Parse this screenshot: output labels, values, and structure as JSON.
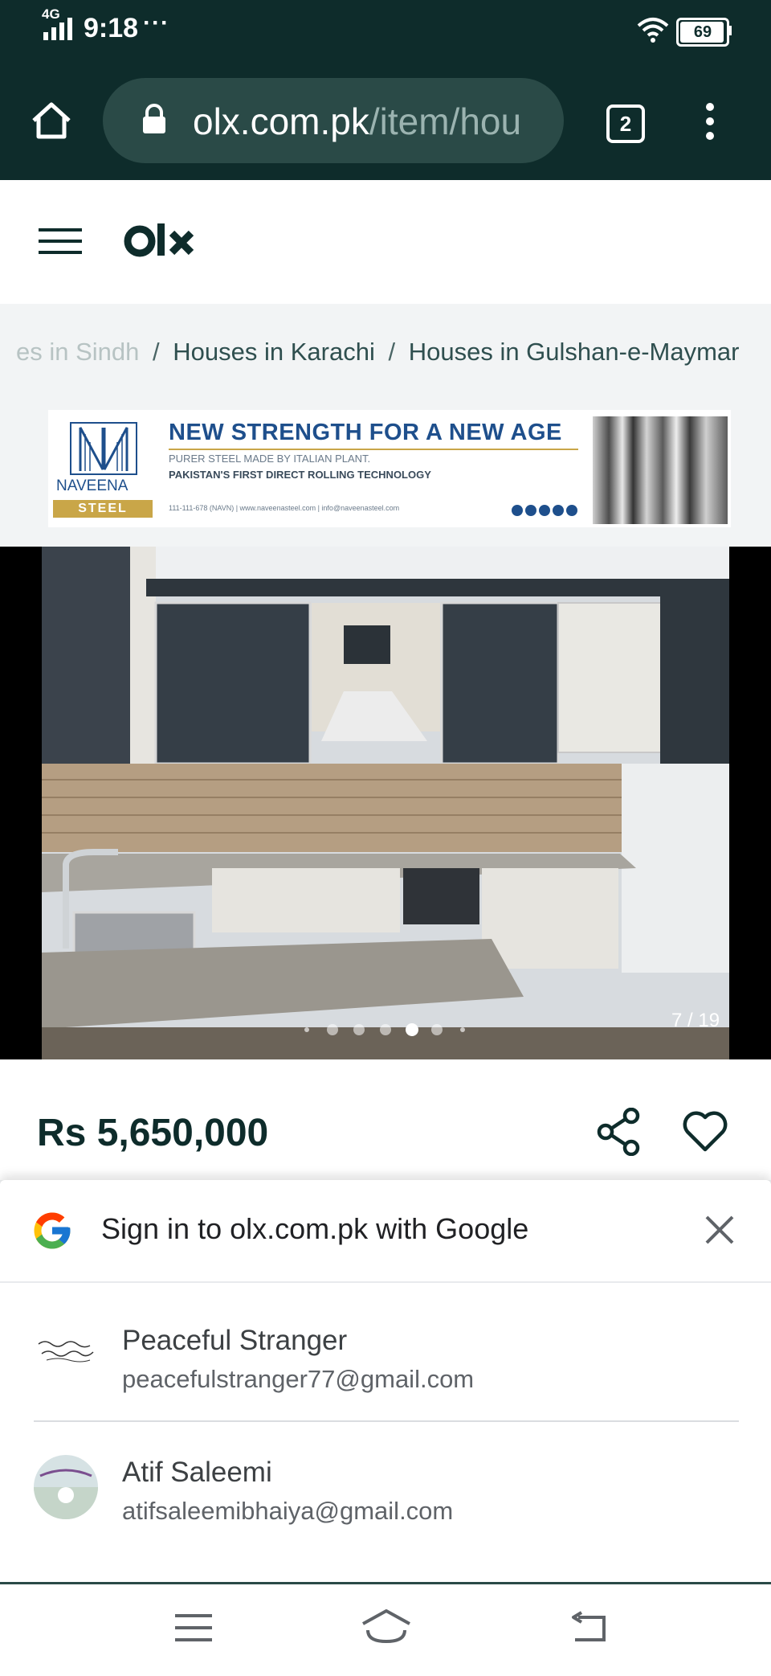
{
  "status_bar": {
    "network": "4G",
    "time": "9:18",
    "dots": "···",
    "battery": "69"
  },
  "browser": {
    "url_host": "olx.com.pk",
    "url_path": "/item/hou",
    "tab_count": "2"
  },
  "header": {
    "logo": "OLX"
  },
  "breadcrumb": {
    "items": [
      "es in Sindh",
      "Houses in Karachi",
      "Houses in Gulshan-e-Maymar"
    ],
    "separator": "/"
  },
  "ad": {
    "headline": "NEW STRENGTH FOR A NEW AGE",
    "line1": "PURER STEEL MADE BY ITALIAN PLANT.",
    "line2": "PAKISTAN'S FIRST DIRECT ROLLING TECHNOLOGY",
    "brand": "NAVEENA",
    "brand_sub": "STEEL",
    "contact": "111-111-678 (NAVN)  |  www.naveenasteel.com  |  info@naveenasteel.com"
  },
  "gallery": {
    "counter": "7 / 19",
    "dots_total": 7,
    "dots_active_index": 4
  },
  "listing": {
    "price": "Rs 5,650,000"
  },
  "google_signin": {
    "title": "Sign in to olx.com.pk with Google",
    "accounts": [
      {
        "name": "Peaceful Stranger",
        "email": "peacefulstranger77@gmail.com"
      },
      {
        "name": "Atif Saleemi",
        "email": "atifsaleemibhaiya@gmail.com"
      }
    ]
  },
  "colors": {
    "olx_dark": "#0e2c2b",
    "url_pill": "#2a4a47",
    "ad_blue": "#1e4f8c",
    "ad_gold": "#c9a648"
  },
  "icons": [
    "home-icon",
    "lock-icon",
    "tab-switcher-icon",
    "overflow-menu-icon",
    "hamburger-icon",
    "share-icon",
    "heart-icon",
    "google-g-icon",
    "close-icon",
    "nav-menu-icon",
    "nav-home-icon",
    "nav-back-icon"
  ]
}
